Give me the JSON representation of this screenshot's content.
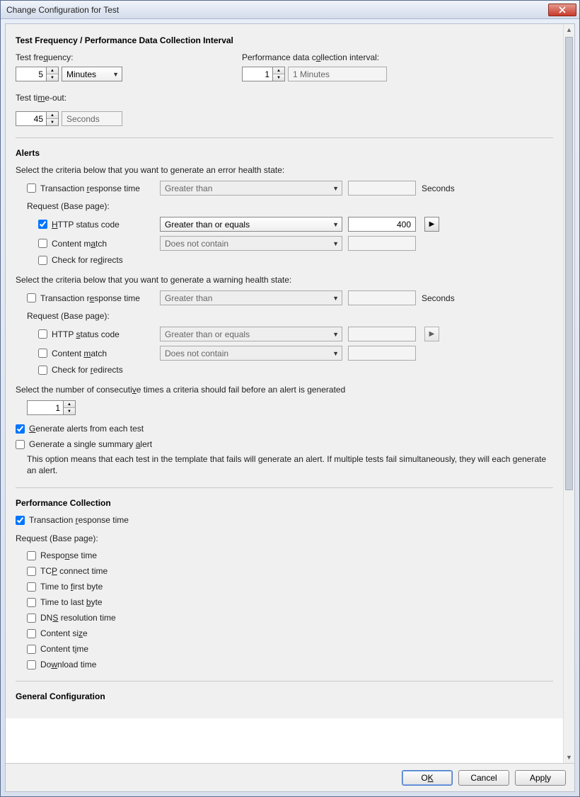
{
  "window": {
    "title": "Change Configuration for Test"
  },
  "section1": {
    "title": "Test Frequency / Performance Data Collection Interval",
    "test_freq_label": "Test frequency:",
    "test_freq_value": "5",
    "test_freq_unit": "Minutes",
    "perf_interval_label": "Performance data collection interval:",
    "perf_interval_value": "1",
    "perf_interval_display": "1 Minutes",
    "timeout_label": "Test time-out:",
    "timeout_value": "45",
    "timeout_unit": "Seconds"
  },
  "alerts": {
    "title": "Alerts",
    "error_desc": "Select the criteria below that you want to generate an error health state:",
    "warning_desc": "Select the criteria below that you want to generate a warning health state:",
    "trans_resp_label": "Transaction response time",
    "greater_than": "Greater than",
    "seconds_label": "Seconds",
    "request_base": "Request (Base page):",
    "http_status_label": "HTTP status code",
    "greater_equal": "Greater than or equals",
    "http_status_value": "400",
    "content_match_label": "Content match",
    "does_not_contain": "Does not contain",
    "check_redirects_label": "Check for redirects",
    "consecutive_desc": "Select the number of consecutive times a criteria should fail before an alert is generated",
    "consecutive_value": "1",
    "gen_each_label": "Generate alerts from each test",
    "gen_single_label": "Generate a single summary alert",
    "note": "This option means that each test in the template that fails will generate an alert. If multiple tests fail simultaneously, they will each generate an alert."
  },
  "perf": {
    "title": "Performance Collection",
    "trans_resp": "Transaction response time",
    "request_base": "Request (Base page):",
    "items": [
      "Response time",
      "TCP connect time",
      "Time to first byte",
      "Time to last byte",
      "DNS resolution time",
      "Content size",
      "Content time",
      "Download time"
    ]
  },
  "general": {
    "title": "General Configuration"
  },
  "buttons": {
    "ok": "OK",
    "cancel": "Cancel",
    "apply": "Apply"
  }
}
